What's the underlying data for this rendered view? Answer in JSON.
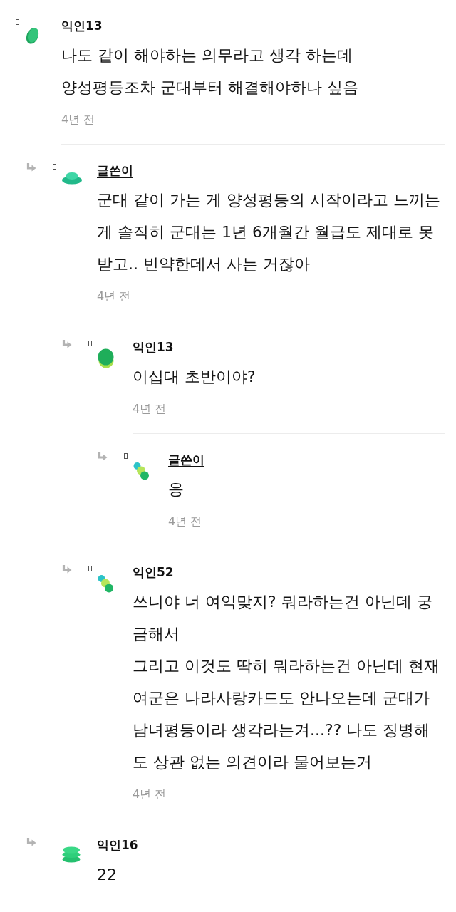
{
  "comments": [
    {
      "name": "익인13",
      "author": false,
      "body": "나도 같이 해야하는 의무라고 생각 하는데\n양성평등조차 군대부터 해결해야하나 싶음",
      "time": "4년 전",
      "children": [
        {
          "name": "글쓴이",
          "author": true,
          "body": "군대 같이 가는 게 양성평등의 시작이라고 느끼는\n게 솔직히 군대는 1년 6개월간 월급도 제대로 못\n받고.. 빈약한데서 사는 거잖아",
          "time": "4년 전",
          "children": [
            {
              "name": "익인13",
              "author": false,
              "body": "이십대 초반이야?",
              "time": "4년 전",
              "children": [
                {
                  "name": "글쓴이",
                  "author": true,
                  "body": "응",
                  "time": "4년 전"
                }
              ]
            },
            {
              "name": "익인52",
              "author": false,
              "body": "쓰니야 너 여익맞지? 뭐라하는건 아닌데 궁\n금해서\n그리고 이것도 딱히 뭐라하는건 아닌데 현재\n여군은 나라사랑카드도 안나오는데 군대가\n남녀평등이라 생각라는겨...?? 나도 징병해\n도 상관 없는 의견이라 물어보는거",
              "time": "4년 전"
            }
          ]
        },
        {
          "name": "익인16",
          "author": false,
          "body": "22"
        }
      ]
    }
  ]
}
